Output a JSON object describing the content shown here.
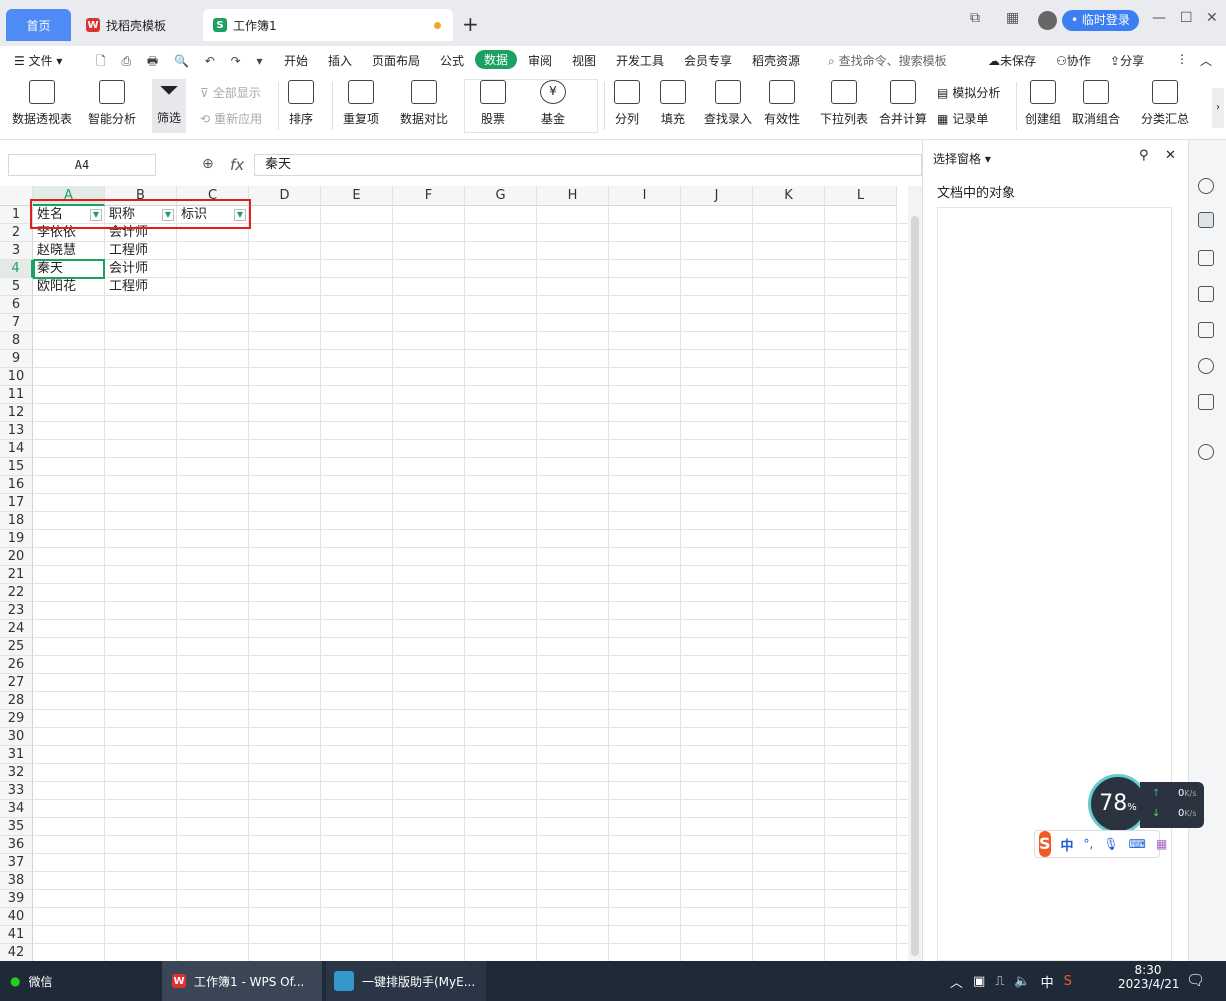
{
  "tabs": {
    "home": "首页",
    "template": "找稻壳模板",
    "workbook": "工作簿1"
  },
  "window": {
    "login": "• 临时登录",
    "min": "—",
    "max": "☐",
    "close": "✕",
    "layout": "1⃞",
    "grid": "▦"
  },
  "menu": {
    "file": "文件",
    "items": [
      "开始",
      "插入",
      "页面布局",
      "公式",
      "数据",
      "审阅",
      "视图",
      "开发工具",
      "会员专享",
      "稻壳资源"
    ],
    "search": "查找命令、搜索模板",
    "unsaved": "未保存",
    "collab": "协作",
    "share": "分享"
  },
  "ribbon": {
    "pivot": "数据透视表",
    "smart": "智能分析",
    "filter": "筛选",
    "show_all": "全部显示",
    "reapply": "重新应用",
    "sort": "排序",
    "dup": "重复项",
    "compare": "数据对比",
    "stock": "股票",
    "fund": "基金",
    "split": "分列",
    "fill": "填充",
    "lookup": "查找录入",
    "valid": "有效性",
    "dropdown": "下拉列表",
    "merge_calc": "合并计算",
    "simulate": "模拟分析",
    "record": "记录单",
    "group": "创建组",
    "ungroup": "取消组合",
    "subtotal": "分类汇总"
  },
  "formula": {
    "name_box": "A4",
    "fx": "fx",
    "value": "秦天"
  },
  "sheet": {
    "columns": [
      "A",
      "B",
      "C",
      "D",
      "E",
      "F",
      "G",
      "H",
      "I",
      "J",
      "K",
      "L"
    ],
    "row_count": 42,
    "cells": [
      [
        "姓名",
        "职称",
        "标识"
      ],
      [
        "李依依",
        "会计师",
        ""
      ],
      [
        "赵晓慧",
        "工程师",
        ""
      ],
      [
        "秦天",
        "会计师",
        ""
      ],
      [
        "欧阳花",
        "工程师",
        ""
      ]
    ]
  },
  "panel": {
    "title": "选择窗格",
    "subtitle": "文档中的对象"
  },
  "taskbar": {
    "wechat": "微信",
    "wps": "工作簿1 - WPS Of...",
    "helper": "一键排版助手(MyE...",
    "time": "8:30",
    "date": "2023/4/21",
    "ime_cn": "中"
  },
  "widgets": {
    "cpu": "78",
    "cpu_unit": "%",
    "up": "0",
    "down": "0",
    "unit": "K/s",
    "ime": "中"
  },
  "colors": {
    "accent": "#1aa260",
    "tab_blue": "#4f8bf5",
    "highlight": "#e02020"
  }
}
